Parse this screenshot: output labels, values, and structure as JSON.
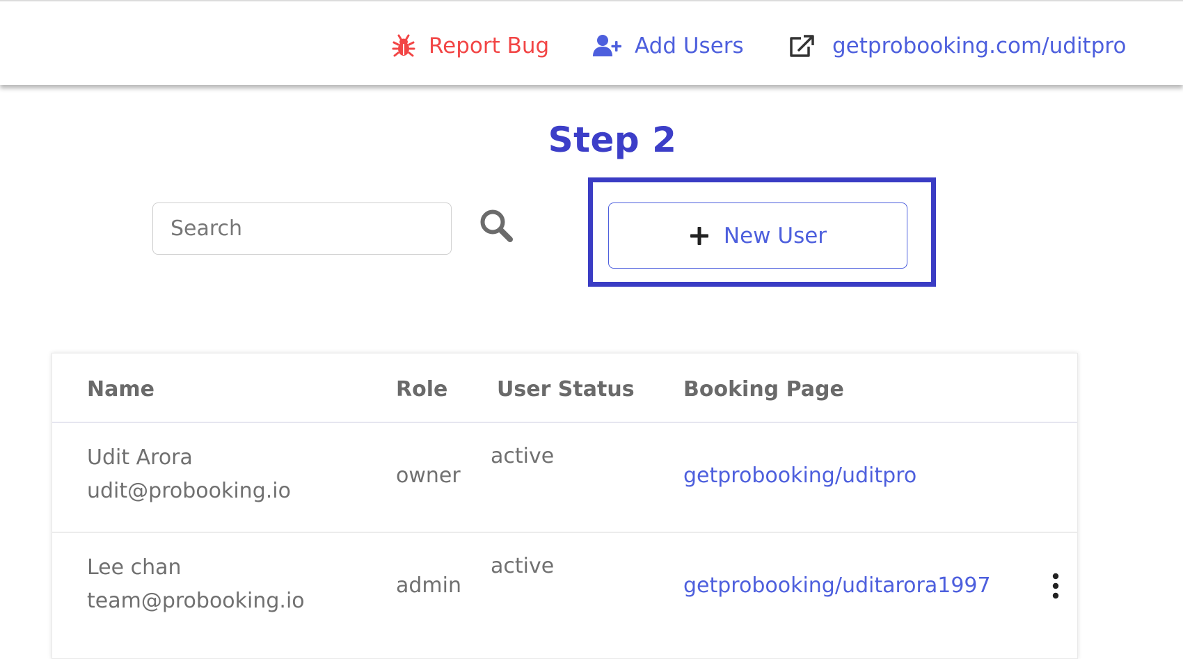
{
  "header": {
    "report_bug": "Report Bug",
    "add_users": "Add Users",
    "booking_link": "getprobooking.com/uditpro"
  },
  "step_title": "Step 2",
  "search": {
    "placeholder": "Search"
  },
  "new_user_label": "New User",
  "table": {
    "columns": {
      "name": "Name",
      "role": "Role",
      "status": "User Status",
      "page": "Booking Page"
    },
    "rows": [
      {
        "name": "Udit Arora",
        "email": "udit@probooking.io",
        "role": "owner",
        "status": "active",
        "page": "getprobooking/uditpro"
      },
      {
        "name": "Lee chan",
        "email": "team@probooking.io",
        "role": "admin",
        "status": "active",
        "page": "getprobooking/uditarora1997"
      }
    ]
  },
  "colors": {
    "accent": "#4d5fdd",
    "step_title": "#3c3ec8",
    "highlight_border": "#3a3cc4",
    "report_bug": "#f24545",
    "text_muted": "#707070"
  },
  "icons": {
    "report_bug": "bug-icon",
    "add_users": "user-plus-icon",
    "booking_link": "external-link-icon",
    "search": "search-icon",
    "new_user": "plus-icon",
    "row_menu": "kebab-menu-icon"
  }
}
